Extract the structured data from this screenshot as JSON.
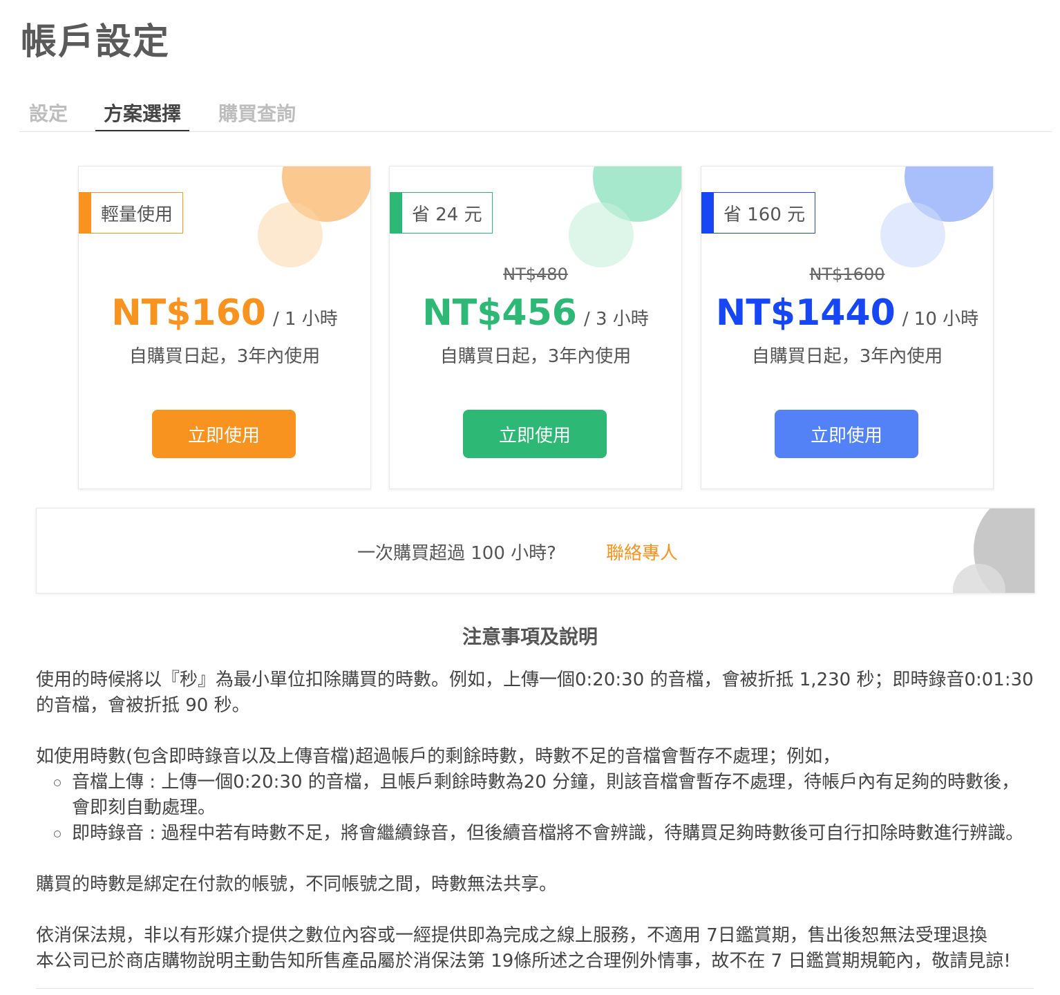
{
  "page": {
    "title": "帳戶設定"
  },
  "tabs": [
    {
      "label": "設定",
      "active": false
    },
    {
      "label": "方案選擇",
      "active": true
    },
    {
      "label": "購買查詢",
      "active": false
    }
  ],
  "plans": [
    {
      "badge": "輕量使用",
      "old_price": "",
      "price": "NT$160",
      "unit": "/ 1 小時",
      "validity": "自購買日起，3年內使用",
      "button": "立即使用",
      "color": "#f7931e",
      "circle_big": "#fbc98f",
      "circle_small": "rgba(252,214,170,0.55)"
    },
    {
      "badge": "省 24 元",
      "old_price": "NT$480",
      "price": "NT$456",
      "unit": "/ 3 小時",
      "validity": "自購買日起，3年內使用",
      "button": "立即使用",
      "color": "#2db875",
      "circle_big": "#a6e8cb",
      "circle_small": "rgba(200,240,218,0.6)"
    },
    {
      "badge": "省 160 元",
      "old_price": "NT$1600",
      "price": "NT$1440",
      "unit": "/ 10 小時",
      "validity": "自購買日起，3年內使用",
      "button": "立即使用",
      "color": "#1747f5",
      "button_color": "#5382f6",
      "circle_big": "#a8bffb",
      "circle_small": "rgba(205,218,253,0.6)"
    }
  ],
  "contact": {
    "text": "一次購買超過 100 小時?",
    "link": "聯絡專人"
  },
  "notes": {
    "heading": "注意事項及說明",
    "p1": "使用的時候將以『秒』為最小單位扣除購買的時數。例如，上傳一個0:20:30 的音檔，會被折抵 1,230 秒；即時錄音0:01:30 的音檔，會被折抵 90 秒。",
    "p2": "如使用時數(包含即時錄音以及上傳音檔)超過帳戶的剩餘時數，時數不足的音檔會暫存不處理；例如，",
    "bullets": [
      "音檔上傳 : 上傳一個0:20:30 的音檔，且帳戶剩餘時數為20 分鐘，則該音檔會暫存不處理，待帳戶內有足夠的時數後，會即刻自動處理。",
      "即時錄音 : 過程中若有時數不足，將會繼續錄音，但後續音檔將不會辨識，待購買足夠時數後可自行扣除時數進行辨識。"
    ],
    "p3": "購買的時數是綁定在付款的帳號，不同帳號之間，時數無法共享。",
    "p4a": "依消保法規，非以有形媒介提供之數位內容或一經提供即為完成之線上服務，不適用 7日鑑賞期，售出後恕無法受理退換",
    "p4b": "本公司已於商店購物說明主動告知所售產品屬於消保法第 19條所述之合理例外情事，故不在 7 日鑑賞期規範內，敬請見諒!"
  }
}
